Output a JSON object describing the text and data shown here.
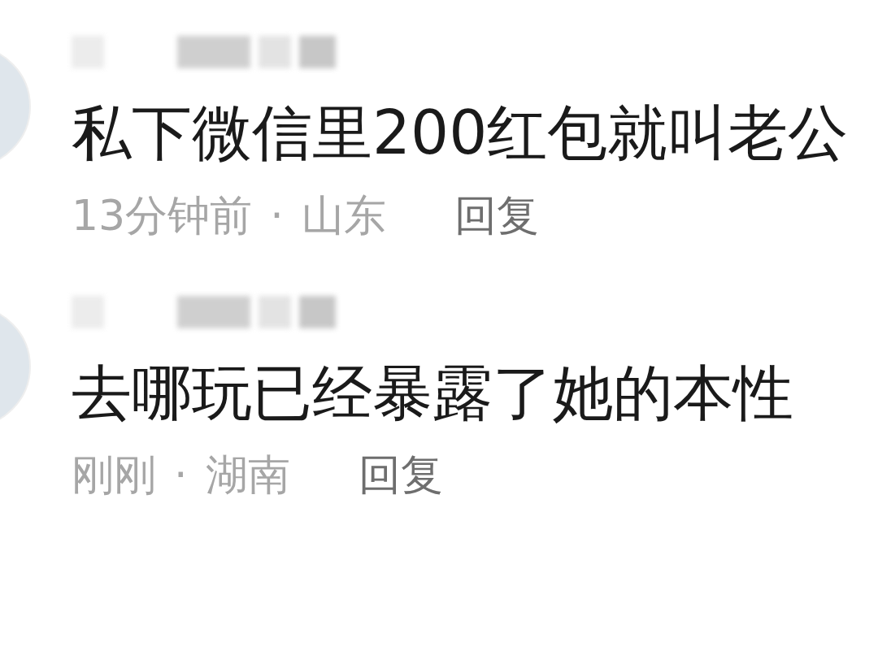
{
  "comments": [
    {
      "text": "私下微信里200红包就叫老公",
      "time": "13分钟前",
      "separator": "·",
      "location": "山东",
      "reply": "回复"
    },
    {
      "text": "去哪玩已经暴露了她的本性",
      "time": "刚刚",
      "separator": "·",
      "location": "湖南",
      "reply": "回复"
    }
  ]
}
